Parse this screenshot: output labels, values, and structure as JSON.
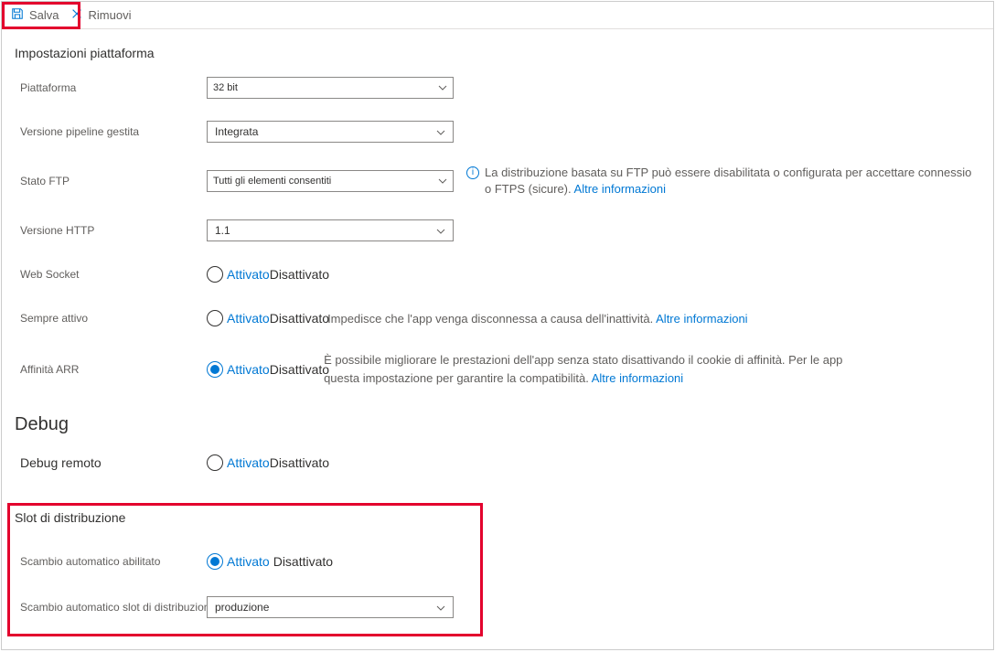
{
  "toolbar": {
    "save": "Salva",
    "remove": "Rimuovi"
  },
  "platform": {
    "section": "Impostazioni piattaforma",
    "platform_label": "Piattaforma",
    "platform_value": "32 bit",
    "pipeline_label": "Versione pipeline gestita",
    "pipeline_value": "Integrata",
    "ftp_label": "Stato FTP",
    "ftp_value": "Tutti gli elementi consentiti",
    "ftp_help1": "La distribuzione basata su FTP può essere disabilitata o configurata per accettare connessio",
    "ftp_help2": "o FTPS (sicure). ",
    "ftp_link": "Altre informazioni",
    "http_label": "Versione HTTP",
    "http_value": "1.1",
    "websocket_label": "Web Socket",
    "alwayson_label": "Sempre attivo",
    "alwayson_help": " Impedisce che l'app venga disconnessa a causa dell'inattività. ",
    "alwayson_link": "Altre informazioni",
    "arr_label": "Affinità ARR",
    "arr_help1": "È possibile migliorare le prestazioni dell'app senza stato disattivando il cookie di affinità. Per le app",
    "arr_help2": "questa impostazione per garantire la compatibilità. ",
    "arr_link": "Altre informazioni"
  },
  "radio": {
    "on": "Attivato",
    "off": "Disattivato"
  },
  "debug": {
    "section": "Debug",
    "remote_label": "Debug remoto"
  },
  "slot": {
    "section": "Slot di distribuzione",
    "autoswap_label": "Scambio automatico abilitato",
    "autoswap_slot_label": "Scambio automatico slot di distribuzione",
    "slot_value": "produzione"
  }
}
